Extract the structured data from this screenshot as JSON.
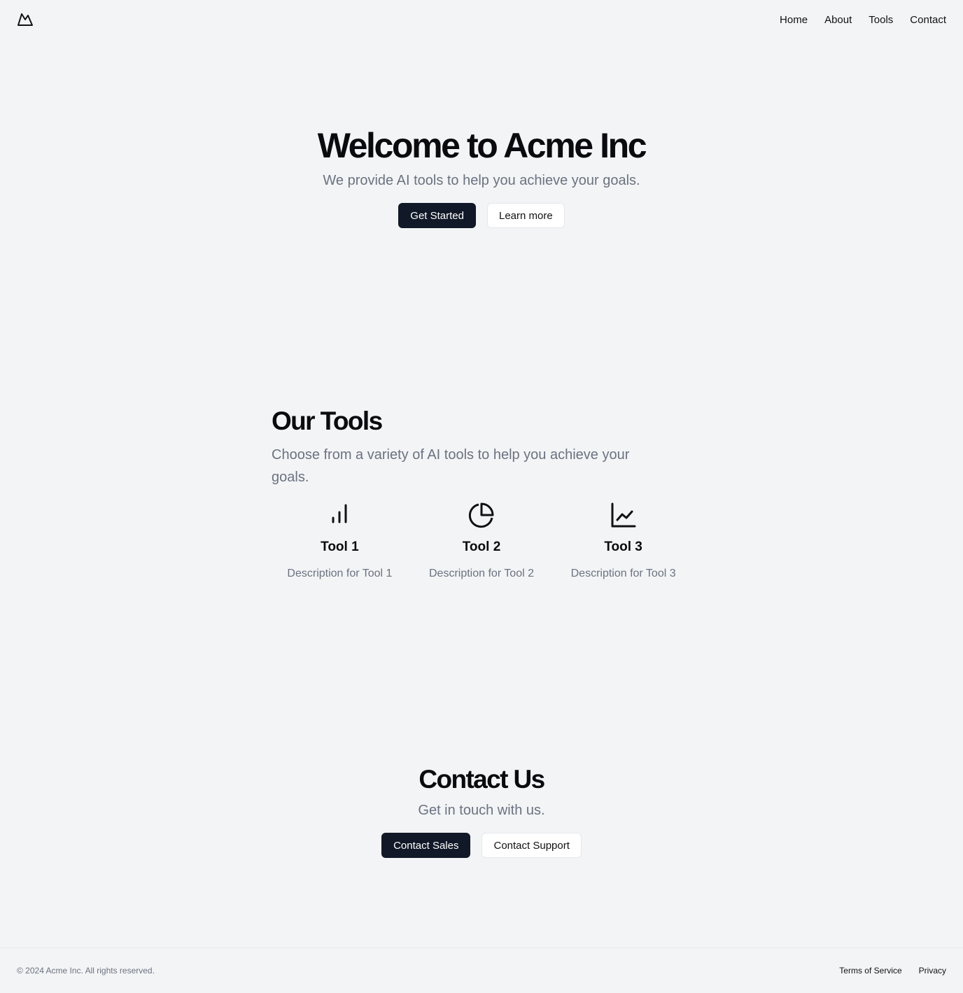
{
  "header": {
    "logo_icon": "mountain-icon",
    "nav": [
      {
        "label": "Home"
      },
      {
        "label": "About"
      },
      {
        "label": "Tools"
      },
      {
        "label": "Contact"
      }
    ]
  },
  "hero": {
    "title": "Welcome to Acme Inc",
    "subtitle": "We provide AI tools to help you achieve your goals.",
    "primary_button": "Get Started",
    "secondary_button": "Learn more"
  },
  "tools": {
    "title": "Our Tools",
    "subtitle": "Choose from a variety of AI tools to help you achieve your goals.",
    "items": [
      {
        "icon": "bar-chart-icon",
        "name": "Tool 1",
        "description": "Description for Tool 1"
      },
      {
        "icon": "pie-chart-icon",
        "name": "Tool 2",
        "description": "Description for Tool 2"
      },
      {
        "icon": "line-chart-icon",
        "name": "Tool 3",
        "description": "Description for Tool 3"
      }
    ]
  },
  "contact": {
    "title": "Contact Us",
    "subtitle": "Get in touch with us.",
    "primary_button": "Contact Sales",
    "secondary_button": "Contact Support"
  },
  "footer": {
    "copyright": "© 2024 Acme Inc. All rights reserved.",
    "links": [
      {
        "label": "Terms of Service"
      },
      {
        "label": "Privacy"
      }
    ]
  },
  "colors": {
    "background": "#f3f4f6",
    "primary": "#111827",
    "muted_text": "#6b7280"
  }
}
